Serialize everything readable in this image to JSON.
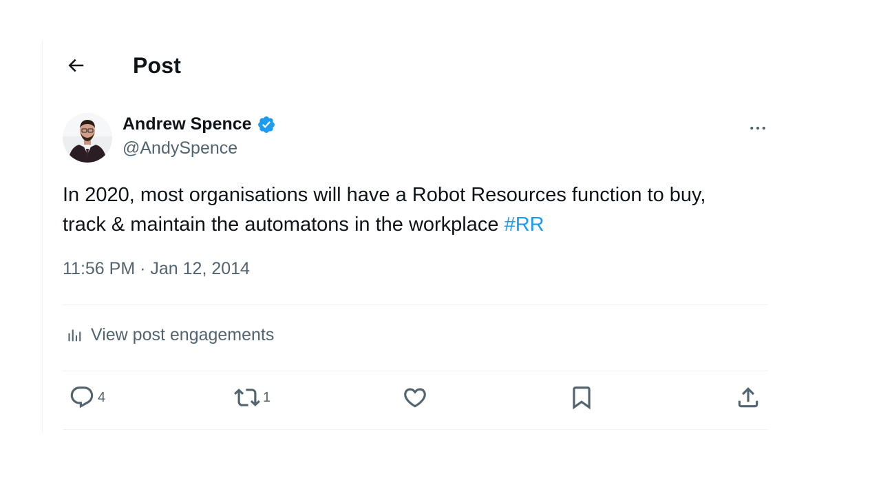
{
  "header": {
    "title": "Post",
    "back_icon": "arrow-left-icon"
  },
  "post": {
    "author": {
      "display_name": "Andrew Spence",
      "handle": "@AndySpence",
      "verified": true,
      "verified_color": "#1d9bf0"
    },
    "text_main": "In 2020, most organisations will have a Robot Resources function to buy, track & maintain  the automatons in the workplace ",
    "hashtag": "#RR",
    "time": "11:56 PM",
    "separator": "·",
    "date": "Jan 12, 2014",
    "engagements_label": "View post engagements"
  },
  "actions": {
    "replies": {
      "icon": "reply-icon",
      "count": "4"
    },
    "reposts": {
      "icon": "repost-icon",
      "count": "1"
    },
    "likes": {
      "icon": "heart-icon",
      "count": ""
    },
    "bookmark": {
      "icon": "bookmark-icon"
    },
    "share": {
      "icon": "share-icon"
    }
  },
  "colors": {
    "text": "#0f1419",
    "secondary": "#536471",
    "accent": "#1d9bf0",
    "divider": "#eff3f4"
  }
}
